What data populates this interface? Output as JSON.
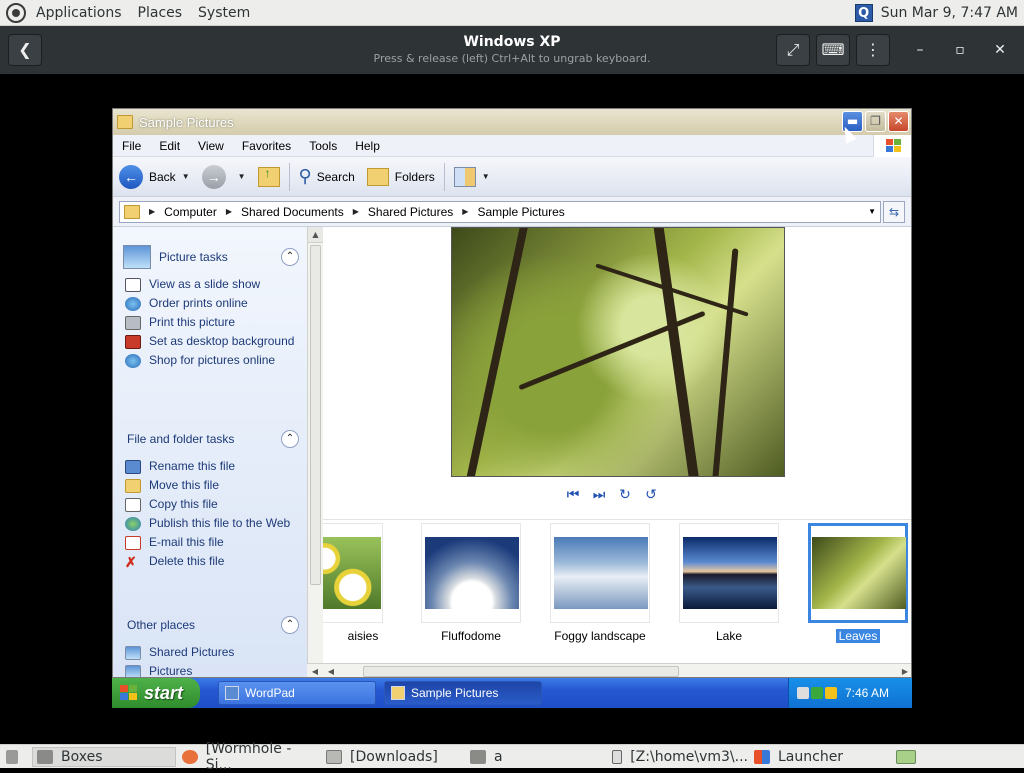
{
  "gnome_top": {
    "menus": [
      "Applications",
      "Places",
      "System"
    ],
    "clock": "Sun Mar  9,  7:47 AM",
    "tray_icon": "Q"
  },
  "boxes": {
    "title": "Windows XP",
    "subtitle": "Press & release (left) Ctrl+Alt to ungrab keyboard.",
    "icons": {
      "back": "back-arrow-icon",
      "fullscreen": "fullscreen-icon",
      "keyboard": "keyboard-icon",
      "menu": "kebab-menu-icon"
    }
  },
  "xp_window": {
    "title": "Sample Pictures",
    "menus": [
      "File",
      "Edit",
      "View",
      "Favorites",
      "Tools",
      "Help"
    ],
    "toolbar": {
      "back": "Back",
      "search": "Search",
      "folders": "Folders"
    },
    "address": [
      "Computer",
      "Shared Documents",
      "Shared Pictures",
      "Sample Pictures"
    ],
    "task_groups": [
      {
        "title": "Picture tasks",
        "tasks": [
          "View as a slide show",
          "Order prints online",
          "Print this picture",
          "Set as desktop background",
          "Shop for pictures online"
        ]
      },
      {
        "title": "File and folder tasks",
        "tasks": [
          "Rename this file",
          "Move this file",
          "Copy this file",
          "Publish this file to the Web",
          "E-mail this file",
          "Delete this file"
        ]
      },
      {
        "title": "Other places",
        "tasks": [
          "Shared Pictures",
          "Pictures"
        ]
      }
    ],
    "thumbnails": [
      {
        "label": "aisies",
        "selected": false
      },
      {
        "label": "Fluffodome",
        "selected": false
      },
      {
        "label": "Foggy landscape",
        "selected": false
      },
      {
        "label": "Lake",
        "selected": false
      },
      {
        "label": "Leaves",
        "selected": true
      }
    ]
  },
  "xp_taskbar": {
    "start": "start",
    "tasks": [
      "WordPad",
      "Sample Pictures"
    ],
    "clock": "7:46 AM"
  },
  "gnome_bottom": {
    "items": [
      "Boxes",
      "[Wormhole - Si...",
      "[Downloads]",
      "a",
      "[Z:\\home\\vm3\\...",
      "Launcher"
    ]
  }
}
